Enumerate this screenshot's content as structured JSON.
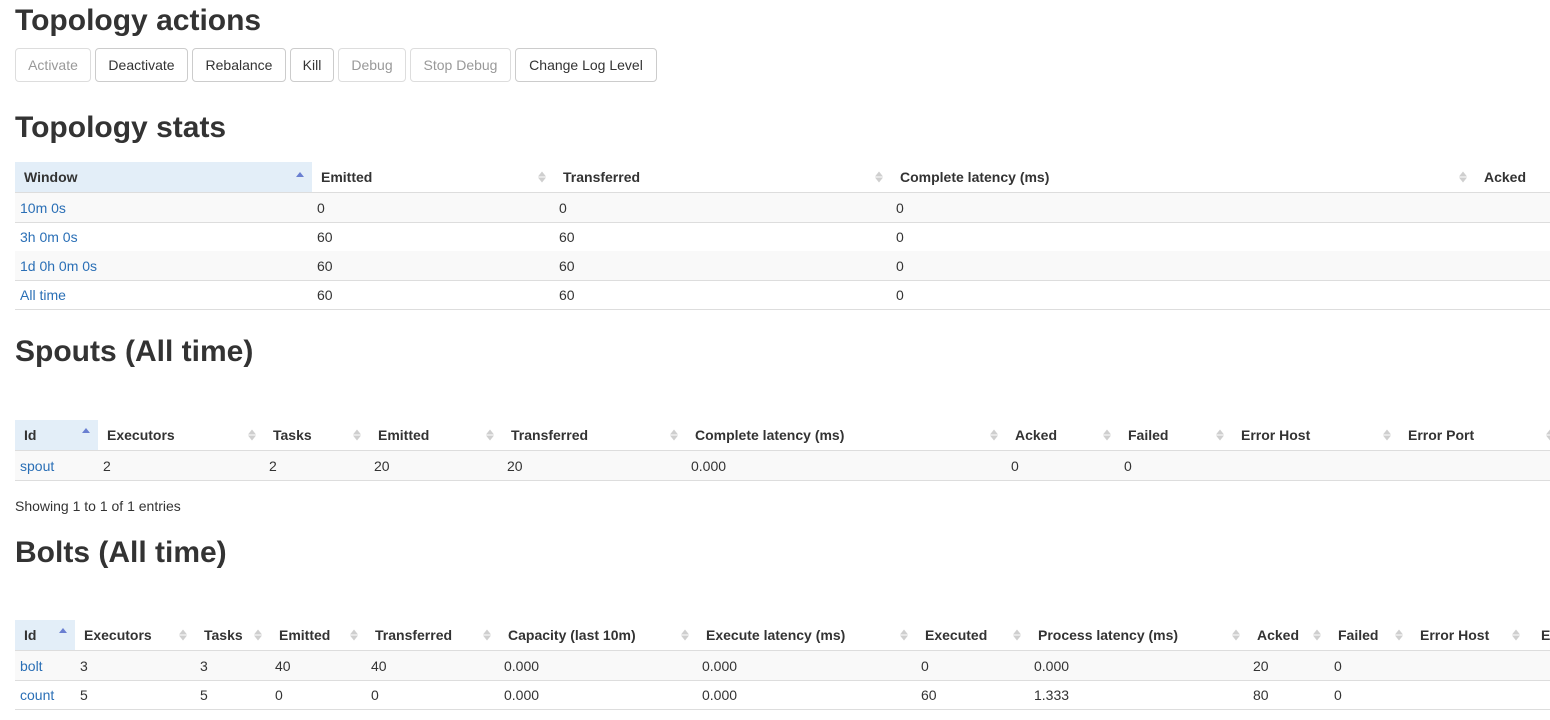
{
  "actions": {
    "title": "Topology actions",
    "buttons": [
      {
        "label": "Activate",
        "disabled": true
      },
      {
        "label": "Deactivate",
        "disabled": false
      },
      {
        "label": "Rebalance",
        "disabled": false
      },
      {
        "label": "Kill",
        "disabled": false
      },
      {
        "label": "Debug",
        "disabled": true
      },
      {
        "label": "Stop Debug",
        "disabled": true
      },
      {
        "label": "Change Log Level",
        "disabled": false
      }
    ]
  },
  "stats": {
    "title": "Topology stats",
    "headers": [
      "Window",
      "Emitted",
      "Transferred",
      "Complete latency (ms)",
      "Acked"
    ],
    "rows": [
      [
        "10m 0s",
        "0",
        "0",
        "0",
        ""
      ],
      [
        "3h 0m 0s",
        "60",
        "60",
        "0",
        ""
      ],
      [
        "1d 0h 0m 0s",
        "60",
        "60",
        "0",
        ""
      ],
      [
        "All time",
        "60",
        "60",
        "0",
        ""
      ]
    ]
  },
  "spouts": {
    "title": "Spouts (All time)",
    "headers": [
      "Id",
      "Executors",
      "Tasks",
      "Emitted",
      "Transferred",
      "Complete latency (ms)",
      "Acked",
      "Failed",
      "Error Host",
      "Error Port"
    ],
    "rows": [
      [
        "spout",
        "2",
        "2",
        "20",
        "20",
        "0.000",
        "0",
        "0",
        "",
        ""
      ]
    ],
    "info": "Showing 1 to 1 of 1 entries"
  },
  "bolts": {
    "title": "Bolts (All time)",
    "headers": [
      "Id",
      "Executors",
      "Tasks",
      "Emitted",
      "Transferred",
      "Capacity (last 10m)",
      "Execute latency (ms)",
      "Executed",
      "Process latency (ms)",
      "Acked",
      "Failed",
      "Error Host",
      "E"
    ],
    "rows": [
      [
        "bolt",
        "3",
        "3",
        "40",
        "40",
        "0.000",
        "0.000",
        "0",
        "0.000",
        "20",
        "0",
        "",
        ""
      ],
      [
        "count",
        "5",
        "5",
        "0",
        "0",
        "0.000",
        "0.000",
        "60",
        "1.333",
        "80",
        "0",
        "",
        ""
      ]
    ]
  },
  "colors": {
    "link": "#2a6fb6",
    "sorted_header": "#e3eef8",
    "sort_active": "#6a7fd1"
  }
}
